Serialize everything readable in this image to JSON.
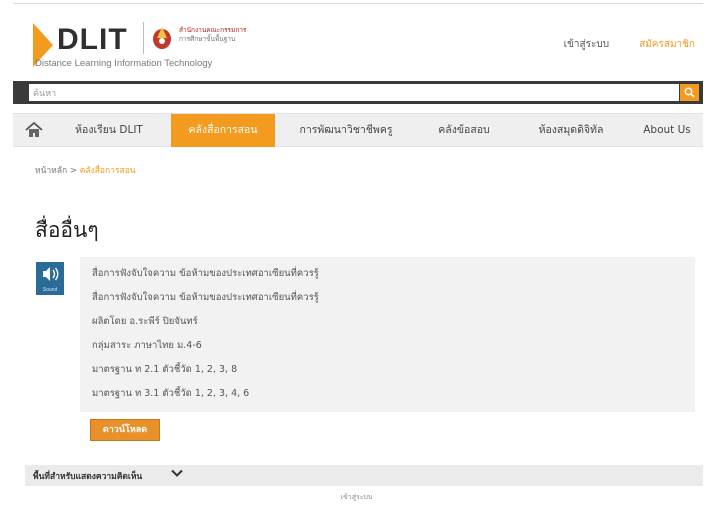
{
  "header": {
    "logo_word": "DLIT",
    "logo_subtitle": "Distance Learning Information Technology",
    "partner_line1": "สำนักงานคณะกรรมการ",
    "partner_line2": "การศึกษาขั้นพื้นฐาน",
    "login_label": "เข้าสู่ระบบ",
    "register_label": "สมัครสมาชิก"
  },
  "search": {
    "placeholder": "ค้นหา",
    "button_icon": "search-icon"
  },
  "nav": {
    "home_icon": "home-icon",
    "items": [
      {
        "label": "ห้องเรียน DLIT"
      },
      {
        "label": "คลังสื่อการสอน"
      },
      {
        "label": "การพัฒนาวิชาชีพครู"
      },
      {
        "label": "คลังข้อสอบ"
      },
      {
        "label": "ห้องสมุดดิจิทัล"
      },
      {
        "label": "About Us"
      }
    ],
    "active_index": 1
  },
  "breadcrumb": {
    "home": "หน้าหลัก",
    "separator": ">",
    "current": "คลังสื่อการสอน"
  },
  "page_title": "สื่ออื่นๆ",
  "media": {
    "type_icon": "sound-icon",
    "type_label": "Sound",
    "lines": [
      "สื่อการฟังจับใจความ ข้อห้ามของประเทศอาเซียนที่ควรรู้",
      "สื่อการฟังจับใจความ ข้อห้ามของประเทศอาเซียนที่ควรรู้",
      "ผลิตโดย อ.ระพีร์ ปิยจันทร์",
      "กลุ่มสาระ ภาษาไทย ม.4-6",
      "มาตรฐาน ท 2.1 ตัวชี้วัด 1, 2, 3, 8",
      "มาตรฐาน ท 3.1 ตัวชี้วัด 1, 2, 3, 4, 6"
    ],
    "download_label": "ดาวน์โหลด"
  },
  "comments": {
    "label": "พื้นที่สำหรับแสดงความคิดเห็น",
    "icon": "chevron-down-icon"
  },
  "footer": {
    "login_label": "เข้าสู่ระบบ"
  },
  "colors": {
    "accent": "#f39b1f",
    "search_bar": "#3a3a3a",
    "sound_icon": "#2b6c97"
  }
}
